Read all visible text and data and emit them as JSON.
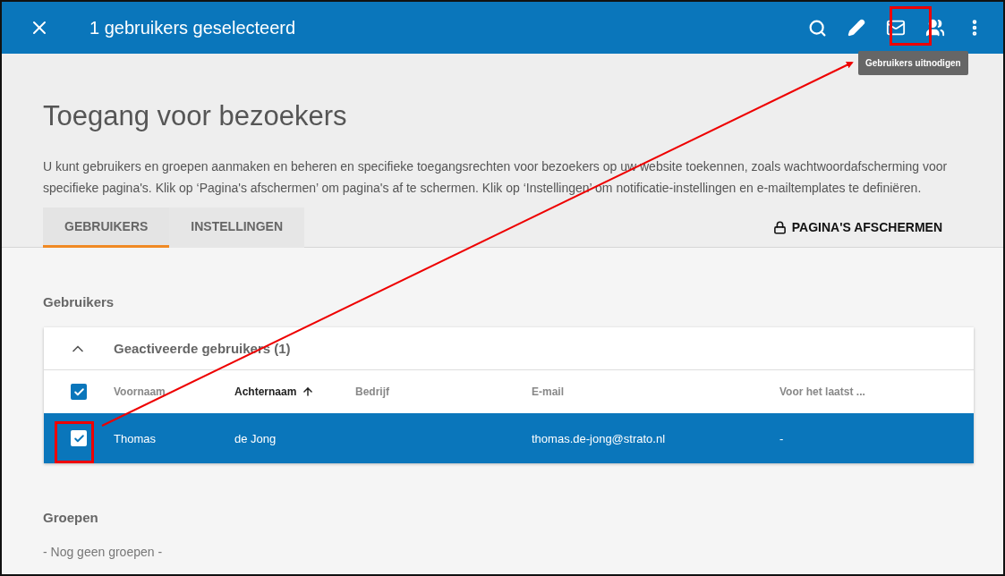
{
  "toolbar": {
    "title": "1 gebruikers geselecteerd",
    "tooltip": "Gebruikers uitnodigen"
  },
  "page": {
    "title": "Toegang voor bezoekers",
    "description": "U kunt gebruikers en groepen aanmaken en beheren en specifieke toegangsrechten voor bezoekers op uw website toekennen, zoals wachtwoordafscherming voor specifieke pagina's. Klik op ‘Pagina's afschermen’ om pagina's af te schermen. Klik op ‘Instellingen’ om notificatie-instellingen en e-mailtemplates te definiëren."
  },
  "tabs": [
    {
      "label": "GEBRUIKERS",
      "selected": true
    },
    {
      "label": "INSTELLINGEN",
      "selected": false
    }
  ],
  "protect_button": "PAGINA'S AFSCHERMEN",
  "users_section": {
    "title": "Gebruikers",
    "group": {
      "title": "Geactiveerde gebruikers (1)",
      "expanded": true,
      "all_checked": true,
      "columns": [
        {
          "label": "Voornaam",
          "sorted": false
        },
        {
          "label": "Achternaam",
          "sorted": true
        },
        {
          "label": "Bedrijf",
          "sorted": false
        },
        {
          "label": "E-mail",
          "sorted": false
        },
        {
          "label": "Voor het laatst ...",
          "sorted": false
        }
      ],
      "rows": [
        {
          "cells": [
            "Thomas",
            "de Jong",
            "",
            "thomas.de-jong@strato.nl",
            "-"
          ],
          "selected": true,
          "checked": true
        }
      ]
    }
  },
  "groups_section": {
    "title": "Groepen",
    "empty": "- Nog geen groepen -"
  }
}
